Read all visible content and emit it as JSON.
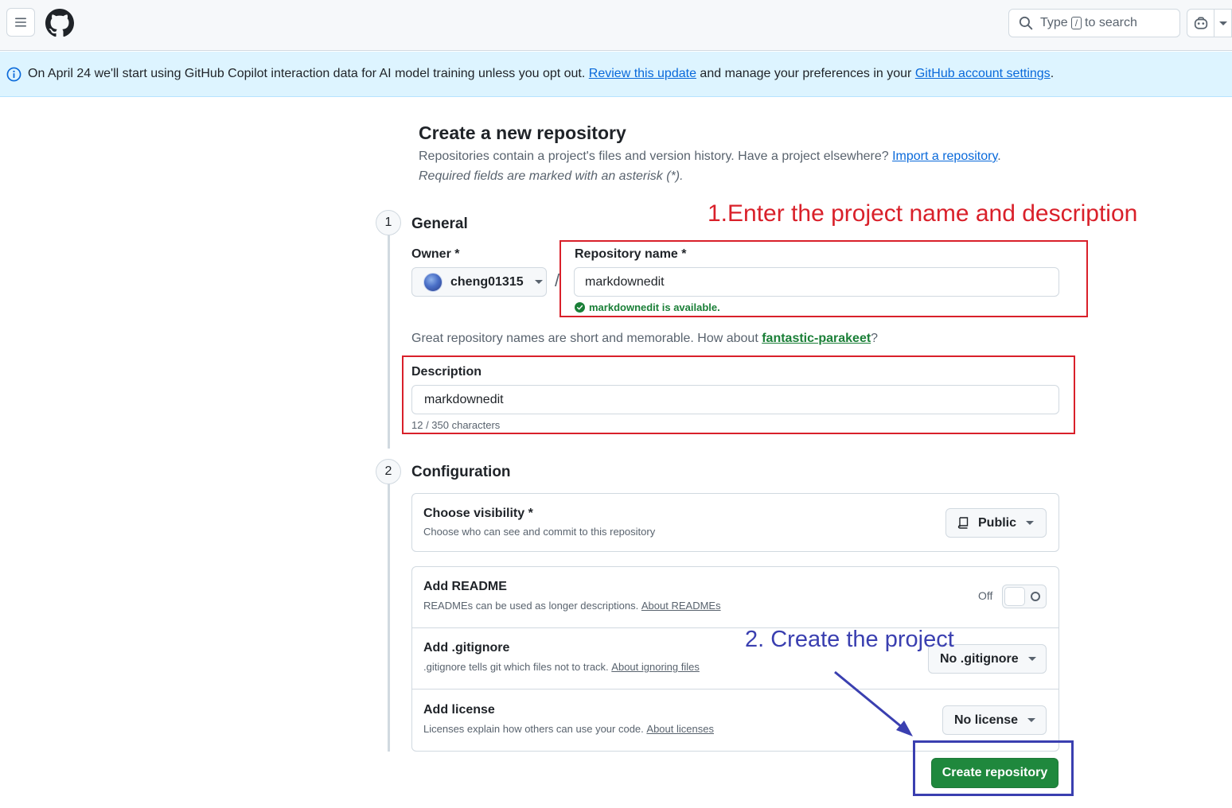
{
  "header": {
    "search_prefix": "Type",
    "search_key": "/",
    "search_suffix": "to search"
  },
  "banner": {
    "text_before": "On April 24 we'll start using GitHub Copilot interaction data for AI model training unless you opt out.",
    "link1": "Review this update",
    "text_middle": "and manage your preferences in your",
    "link2": "GitHub account settings",
    "text_end": "."
  },
  "page": {
    "title": "Create a new repository",
    "subtitle_text": "Repositories contain a project's files and version history. Have a project elsewhere?",
    "import_link": "Import a repository",
    "subtitle_end": ".",
    "required_note": "Required fields are marked with an asterisk (*)."
  },
  "general": {
    "step_number": "1",
    "title": "General",
    "owner_label": "Owner *",
    "owner_value": "cheng01315",
    "slash": "/",
    "repo_name_label": "Repository name *",
    "repo_name_value": "markdownedit",
    "availability": "markdownedit is available.",
    "suggestion_text": "Great repository names are short and memorable. How about",
    "suggestion_link": "fantastic-parakeet",
    "suggestion_end": "?",
    "description_label": "Description",
    "description_value": "markdownedit",
    "char_count": "12 / 350 characters"
  },
  "configuration": {
    "step_number": "2",
    "title": "Configuration",
    "visibility": {
      "title": "Choose visibility *",
      "desc": "Choose who can see and commit to this repository",
      "value": "Public"
    },
    "readme": {
      "title": "Add README",
      "desc": "READMEs can be used as longer descriptions.",
      "link": "About READMEs",
      "toggle_label": "Off"
    },
    "gitignore": {
      "title": "Add .gitignore",
      "desc": ".gitignore tells git which files not to track.",
      "link": "About ignoring files",
      "value": "No .gitignore"
    },
    "license": {
      "title": "Add license",
      "desc": "Licenses explain how others can use your code.",
      "link": "About licenses",
      "value": "No license"
    }
  },
  "actions": {
    "create_button": "Create repository"
  },
  "annotations": {
    "step1": "1.Enter the project name and description",
    "step2": "2. Create the project",
    "red_color": "#d9202a",
    "blue_color": "#3a3fb0"
  },
  "colors": {
    "primary_button": "#1f883d",
    "link": "#0969da",
    "success": "#1a7f37",
    "banner_bg": "#ddf4ff"
  }
}
